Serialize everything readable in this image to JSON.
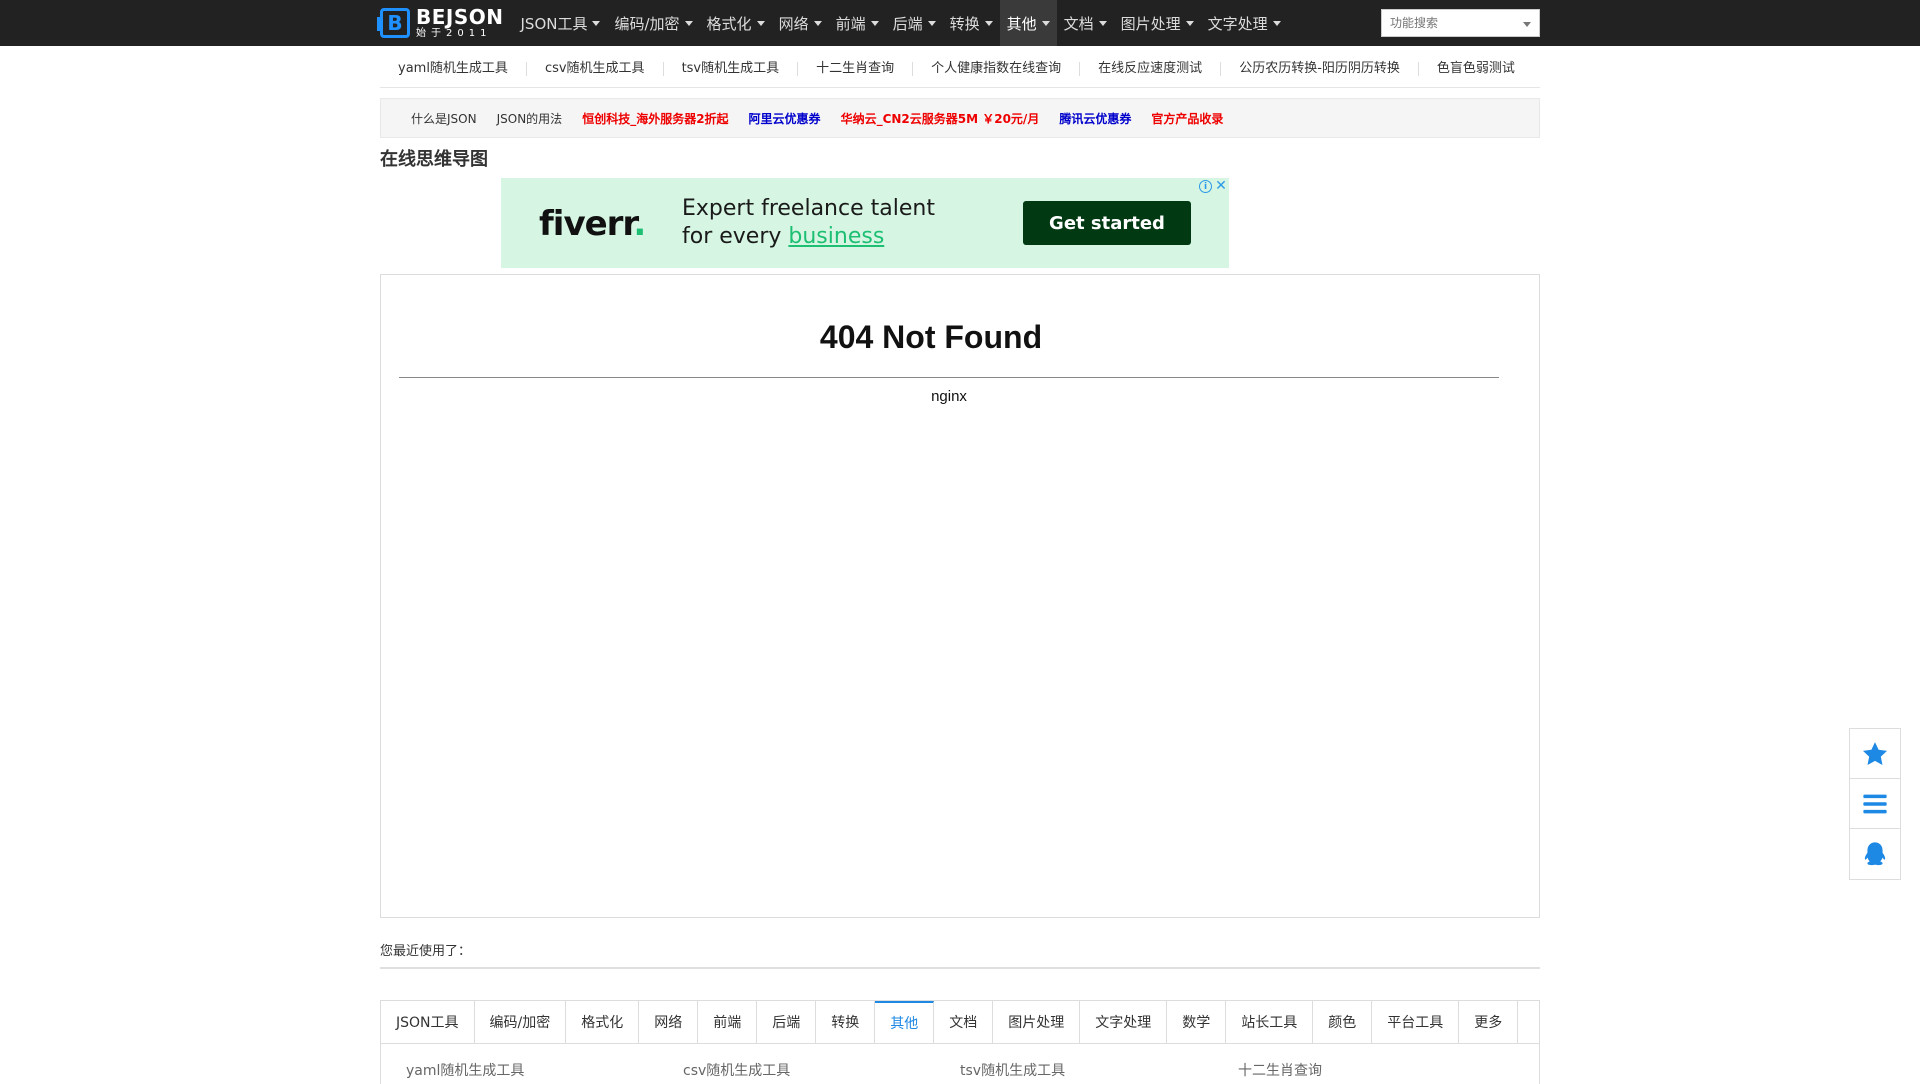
{
  "navbar": {
    "logo_title": "BEJSON",
    "logo_sub": "始于2011",
    "menu": [
      {
        "label": "JSON工具",
        "active": false
      },
      {
        "label": "编码/加密",
        "active": false
      },
      {
        "label": "格式化",
        "active": false
      },
      {
        "label": "网络",
        "active": false
      },
      {
        "label": "前端",
        "active": false
      },
      {
        "label": "后端",
        "active": false
      },
      {
        "label": "转换",
        "active": false
      },
      {
        "label": "其他",
        "active": true
      },
      {
        "label": "文档",
        "active": false
      },
      {
        "label": "图片处理",
        "active": false
      },
      {
        "label": "文字处理",
        "active": false
      }
    ],
    "search_placeholder": "功能搜索"
  },
  "quick_links": [
    "yaml随机生成工具",
    "csv随机生成工具",
    "tsv随机生成工具",
    "十二生肖查询",
    "个人健康指数在线查询",
    "在线反应速度测试",
    "公历农历转换-阳历阴历转换",
    "色盲色弱测试"
  ],
  "promo": [
    {
      "label": "什么是JSON",
      "style": "plain"
    },
    {
      "label": "JSON的用法",
      "style": "plain"
    },
    {
      "label": "恒创科技_海外服务器2折起",
      "style": "red"
    },
    {
      "label": "阿里云优惠券",
      "style": "blue"
    },
    {
      "label": "华纳云_CN2云服务器5M ￥20元/月",
      "style": "red"
    },
    {
      "label": "腾讯云优惠券",
      "style": "blue"
    },
    {
      "label": "官方产品收录",
      "style": "red"
    }
  ],
  "page_title": "在线思维导图",
  "ad": {
    "brand": "fiverr",
    "brand_dot": ".",
    "line1": "Expert freelance talent",
    "line2_prefix": "for every ",
    "line2_highlight": "business",
    "button": "Get started",
    "info_glyph": "i",
    "close_glyph": "✕",
    "colors": {
      "background": "#d6f5e3",
      "button": "#003912",
      "accent": "#1dbf73"
    }
  },
  "error": {
    "title": "404 Not Found",
    "server": "nginx"
  },
  "recent_label": "您最近使用了：",
  "tabs": [
    {
      "label": "JSON工具",
      "active": false
    },
    {
      "label": "编码/加密",
      "active": false
    },
    {
      "label": "格式化",
      "active": false
    },
    {
      "label": "网络",
      "active": false
    },
    {
      "label": "前端",
      "active": false
    },
    {
      "label": "后端",
      "active": false
    },
    {
      "label": "转换",
      "active": false
    },
    {
      "label": "其他",
      "active": true
    },
    {
      "label": "文档",
      "active": false
    },
    {
      "label": "图片处理",
      "active": false
    },
    {
      "label": "文字处理",
      "active": false
    },
    {
      "label": "数学",
      "active": false
    },
    {
      "label": "站长工具",
      "active": false
    },
    {
      "label": "颜色",
      "active": false
    },
    {
      "label": "平台工具",
      "active": false
    },
    {
      "label": "更多",
      "active": false
    }
  ],
  "tool_list": [
    "yaml随机生成工具",
    "csv随机生成工具",
    "tsv随机生成工具",
    "十二生肖查询"
  ],
  "float_bar": [
    {
      "icon": "star-icon"
    },
    {
      "icon": "menu-icon"
    },
    {
      "icon": "qq-icon"
    }
  ],
  "colors": {
    "navbar": "#222222",
    "accent": "#1e88e5"
  }
}
